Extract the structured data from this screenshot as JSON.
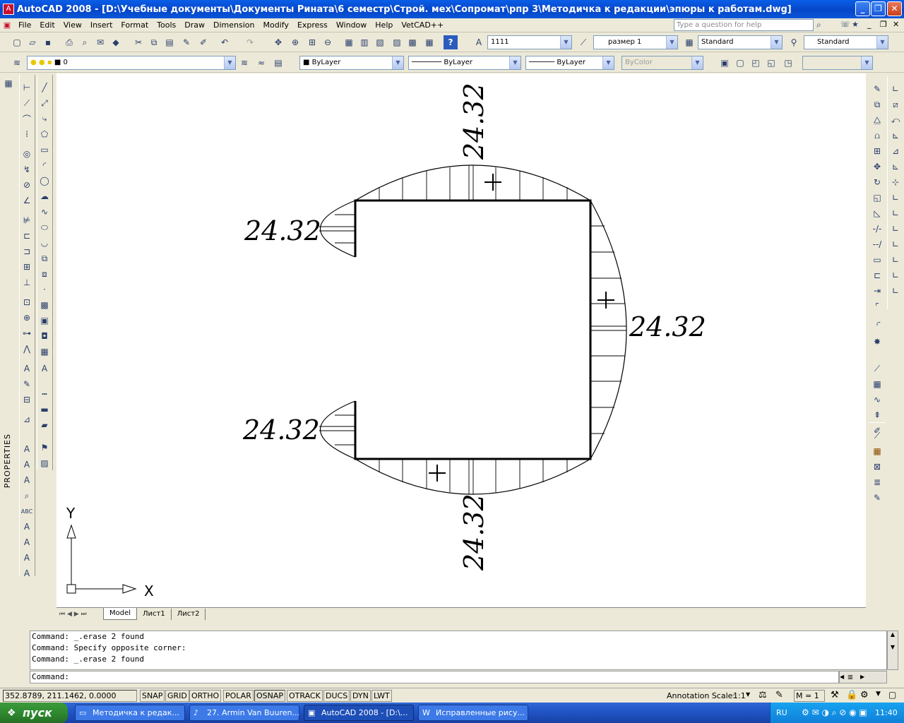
{
  "window": {
    "title": "AutoCAD 2008 - [D:\\Учебные документы\\Документы Рината\\6 семестр\\Строй. мех\\Сопромат\\рпр 3\\Методичка к редакции\\эпюры к работам.dwg]",
    "min": "_",
    "max": "❐",
    "close": "✕"
  },
  "menu": [
    "File",
    "Edit",
    "View",
    "Insert",
    "Format",
    "Tools",
    "Draw",
    "Dimension",
    "Modify",
    "Express",
    "Window",
    "Help",
    "VetCAD++"
  ],
  "help_placeholder": "Type a question for help",
  "toolbar": {
    "text_style_value": "1111",
    "dim_style_value": "размер 1",
    "table_style_value": "Standard",
    "multileader_style_value": "Standard",
    "layer_value": "0",
    "color_value": "ByLayer",
    "linetype_value": "ByLayer",
    "lineweight_value": "ByLayer",
    "plotstyle_value": "ByColor"
  },
  "properties_label": "PROPERTIES",
  "drawing": {
    "labels": {
      "top": "24.32",
      "left_upper": "24.32",
      "right": "24.32",
      "left_lower": "24.32",
      "bottom": "24.32"
    },
    "plus_sign": "+",
    "ucs_x": "X",
    "ucs_y": "Y"
  },
  "layout_tabs": [
    "Model",
    "Лист1",
    "Лист2"
  ],
  "command": {
    "history": [
      "Command: _.erase 2 found",
      "Command: Specify opposite corner:",
      "Command: _.erase 2 found"
    ],
    "prompt": "Command:"
  },
  "status": {
    "coords": "352.8789, 211.1462, 0.0000",
    "toggles": [
      "SNAP",
      "GRID",
      "ORTHO",
      "POLAR",
      "OSNAP",
      "OTRACK",
      "DUCS",
      "DYN",
      "LWT"
    ],
    "toggles_on": [
      "OSNAP"
    ],
    "annotation_scale_label": "Annotation Scale:",
    "annotation_scale_value": "1:1",
    "m_value": "M = 1"
  },
  "taskbar": {
    "start": "пуск",
    "items": [
      "Методичка к редак...",
      "27. Armin Van Buuren...",
      "AutoCAD 2008 - [D:\\...",
      "Исправленные рису..."
    ],
    "lang": "RU",
    "time": "11:40"
  },
  "colors": {
    "titlebar": "#0a5ee8",
    "taskbar": "#2156c8",
    "start": "#2f8a2f",
    "canvas": "#ffffff"
  }
}
